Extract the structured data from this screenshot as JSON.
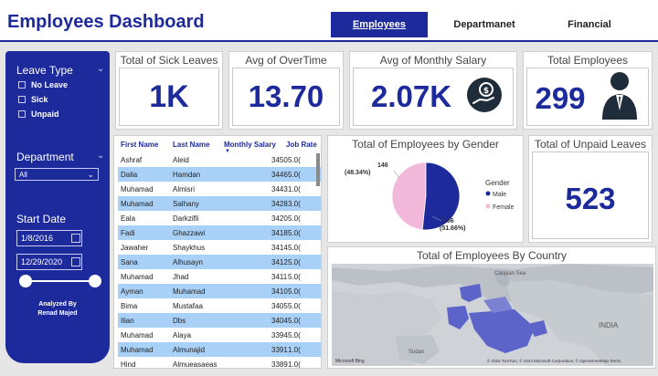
{
  "header": {
    "title": "Employees Dashboard",
    "tabs": [
      {
        "label": "Employees",
        "active": true
      },
      {
        "label": "Departmanet",
        "active": false
      },
      {
        "label": "Financial",
        "active": false
      }
    ]
  },
  "sidebar": {
    "leave_type": {
      "label": "Leave Type",
      "options": [
        "No Leave",
        "Sick",
        "Unpaid"
      ]
    },
    "department": {
      "label": "Department",
      "selected": "All"
    },
    "start_date": {
      "label": "Start Date",
      "from": "1/8/2016",
      "to": "12/29/2020"
    },
    "credit_line1": "Analyzed By",
    "credit_line2": "Renad Majed"
  },
  "kpis": {
    "sick_leaves": {
      "title": "Total of Sick Leaves",
      "value": "1K"
    },
    "overtime": {
      "title": "Avg of OverTime",
      "value": "13.70"
    },
    "salary": {
      "title": "Avg of Monthly Salary",
      "value": "2.07K"
    },
    "employees": {
      "title": "Total Employees",
      "value": "299"
    },
    "unpaid": {
      "title": "Total of Unpaid Leaves",
      "value": "523"
    }
  },
  "table": {
    "columns": [
      "First Name",
      "Last Name",
      "Monthly Salary",
      "Job Rate"
    ],
    "rows": [
      {
        "first": "Ashraf",
        "last": "Aleid",
        "salary": "3450",
        "rate": "5.0("
      },
      {
        "first": "Dalia",
        "last": "Hamdan",
        "salary": "3446",
        "rate": "5.0("
      },
      {
        "first": "Muhamad",
        "last": "Almisri",
        "salary": "3443",
        "rate": "1.0("
      },
      {
        "first": "Muhamad",
        "last": "Salhany",
        "salary": "3428",
        "rate": "3.0("
      },
      {
        "first": "Eala",
        "last": "Darkzifli",
        "salary": "3420",
        "rate": "5.0("
      },
      {
        "first": "Fadi",
        "last": "Ghazzawi",
        "salary": "3418",
        "rate": "5.0("
      },
      {
        "first": "Jawaher",
        "last": "Shaykhus",
        "salary": "3414",
        "rate": "5.0("
      },
      {
        "first": "Sana",
        "last": "Alhusayn",
        "salary": "3412",
        "rate": "5.0("
      },
      {
        "first": "Muhamad",
        "last": "Jhad",
        "salary": "3411",
        "rate": "5.0("
      },
      {
        "first": "Ayman",
        "last": "Muhamad",
        "salary": "3410",
        "rate": "5.0("
      },
      {
        "first": "Bima",
        "last": "Mustafaa",
        "salary": "3405",
        "rate": "5.0("
      },
      {
        "first": "Ilian",
        "last": "Dbs",
        "salary": "3404",
        "rate": "5.0("
      },
      {
        "first": "Muhamad",
        "last": "Alaya",
        "salary": "3394",
        "rate": "5.0("
      },
      {
        "first": "Muhamad",
        "last": "Almunajid",
        "salary": "3391",
        "rate": "1.0("
      },
      {
        "first": "Hind",
        "last": "Almueasaeas",
        "salary": "3389",
        "rate": "1.0("
      }
    ]
  },
  "gender_chart": {
    "title": "Total of Employees by Gender",
    "legend_title": "Gender",
    "male_label": "Male",
    "female_label": "Female",
    "male_value": "156",
    "male_pct": "(51.66%)",
    "female_value": "146",
    "female_pct": "(48.34%)"
  },
  "chart_data": {
    "type": "pie",
    "title": "Total of Employees by Gender",
    "categories": [
      "Male",
      "Female"
    ],
    "values": [
      156,
      146
    ],
    "percentages": [
      51.66,
      48.34
    ],
    "colors": [
      "#1d2a9c",
      "#f2b8d9"
    ],
    "legend_position": "right"
  },
  "map": {
    "title": "Total of Employees By Country",
    "attribution": "© 2024 TomTom, © 2024 Microsoft Corporation, © OpenStreetMap Terms",
    "logo": "Microsoft Bing",
    "labels": [
      "Caspian Sea",
      "INDIA",
      "Sudan"
    ]
  },
  "colors": {
    "accent": "#1d2a9c",
    "row_highlight": "#a9d1f7",
    "female": "#f2b8d9"
  }
}
